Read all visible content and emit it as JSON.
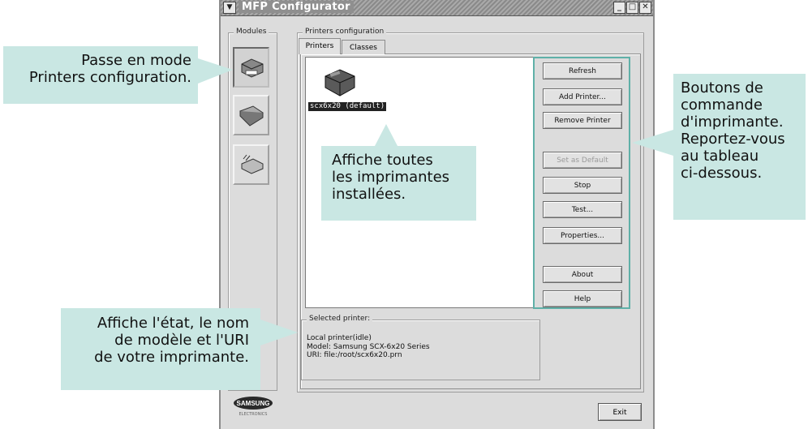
{
  "window": {
    "title": "MFP Configurator",
    "menu_icon": "chevron-down-icon",
    "minimize_icon": "minimize-icon",
    "maximize_icon": "maximize-icon",
    "close_icon": "close-icon"
  },
  "modules": {
    "legend": "Modules",
    "items": [
      {
        "icon": "printer-module-icon",
        "active": true
      },
      {
        "icon": "scanner-module-icon",
        "active": false
      },
      {
        "icon": "port-module-icon",
        "active": false
      }
    ]
  },
  "printers_config": {
    "legend": "Printers configuration",
    "tabs": [
      {
        "label": "Printers",
        "active": true
      },
      {
        "label": "Classes",
        "active": false
      }
    ],
    "printer_item": {
      "label": "scx6x20 (default)",
      "icon": "printer-icon"
    },
    "buttons": [
      {
        "label": "Refresh",
        "enabled": true
      },
      {
        "label": "Add Printer...",
        "enabled": true
      },
      {
        "label": "Remove Printer",
        "enabled": true
      },
      {
        "label": "Set as Default",
        "enabled": false
      },
      {
        "label": "Stop",
        "enabled": true
      },
      {
        "label": "Test...",
        "enabled": true
      },
      {
        "label": "Properties...",
        "enabled": true
      },
      {
        "label": "About",
        "enabled": true
      },
      {
        "label": "Help",
        "enabled": true
      }
    ],
    "selected": {
      "legend": "Selected printer:",
      "status": "Local printer(idle)",
      "model": "Model: Samsung SCX-6x20 Series",
      "uri": "URI: file:/root/scx6x20.prn"
    }
  },
  "exit_label": "Exit",
  "logo": {
    "text": "SAMSUNG",
    "sub": "ELECTRONICS"
  },
  "callouts": {
    "modules": [
      "Passe en mode",
      "Printers configuration."
    ],
    "list": [
      "Affiche toutes",
      "les imprimantes",
      "installées."
    ],
    "buttons": [
      "Boutons de",
      "commande",
      "d'imprimante.",
      "Reportez-vous",
      "au tableau",
      "ci-dessous."
    ],
    "status": [
      "Affiche l'état, le nom",
      "de modèle et l'URI",
      "de votre imprimante."
    ]
  },
  "colors": {
    "callout_bg": "#c9e7e3",
    "highlight_border": "#5fb0a8"
  }
}
